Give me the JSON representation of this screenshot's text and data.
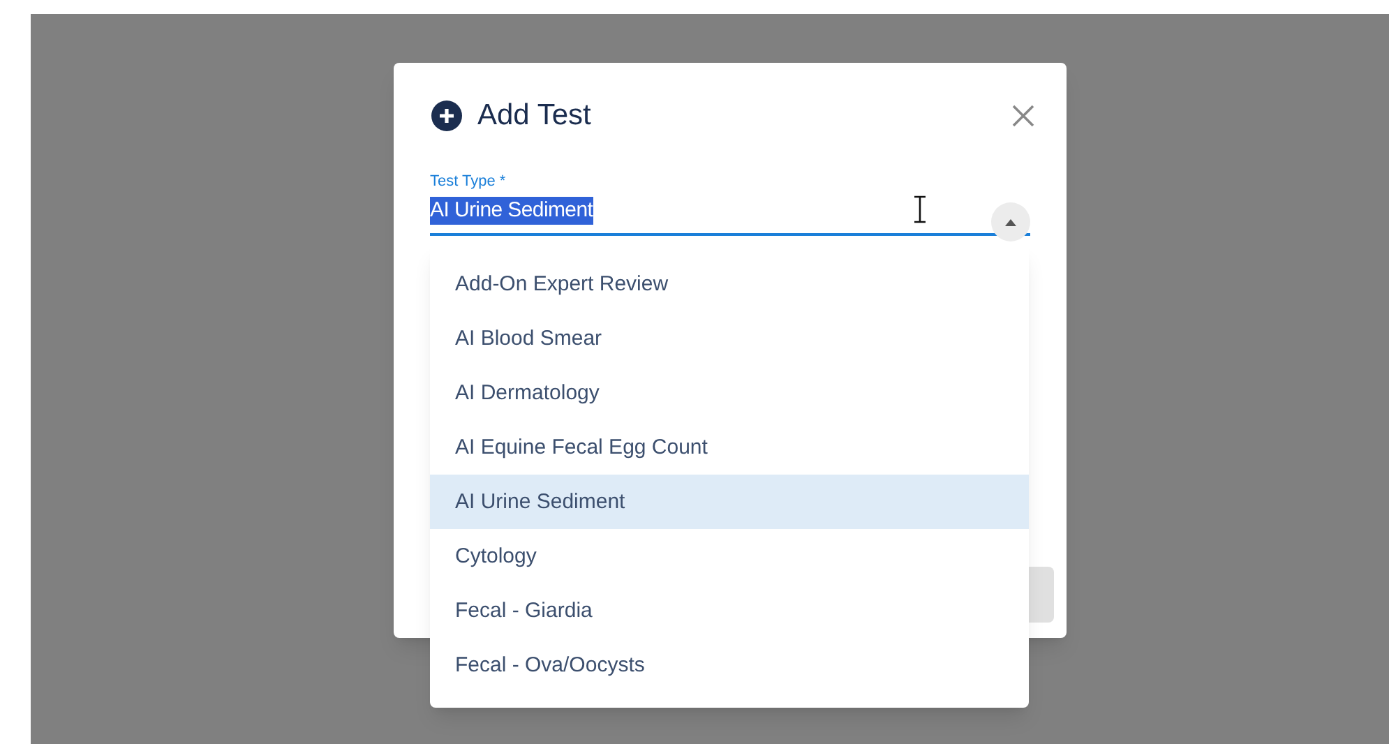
{
  "dialog": {
    "title": "Add Test",
    "field": {
      "label": "Test Type *",
      "value": "AI Urine Sediment",
      "text_selected": true,
      "expanded": true
    }
  },
  "options": [
    {
      "label": "Add-On Expert Review",
      "selected": false
    },
    {
      "label": "AI Blood Smear",
      "selected": false
    },
    {
      "label": "AI Dermatology",
      "selected": false
    },
    {
      "label": "AI Equine Fecal Egg Count",
      "selected": false
    },
    {
      "label": "AI Urine Sediment",
      "selected": true
    },
    {
      "label": "Cytology",
      "selected": false
    },
    {
      "label": "Fecal - Giardia",
      "selected": false
    },
    {
      "label": "Fecal - Ova/Oocysts",
      "selected": false
    }
  ]
}
